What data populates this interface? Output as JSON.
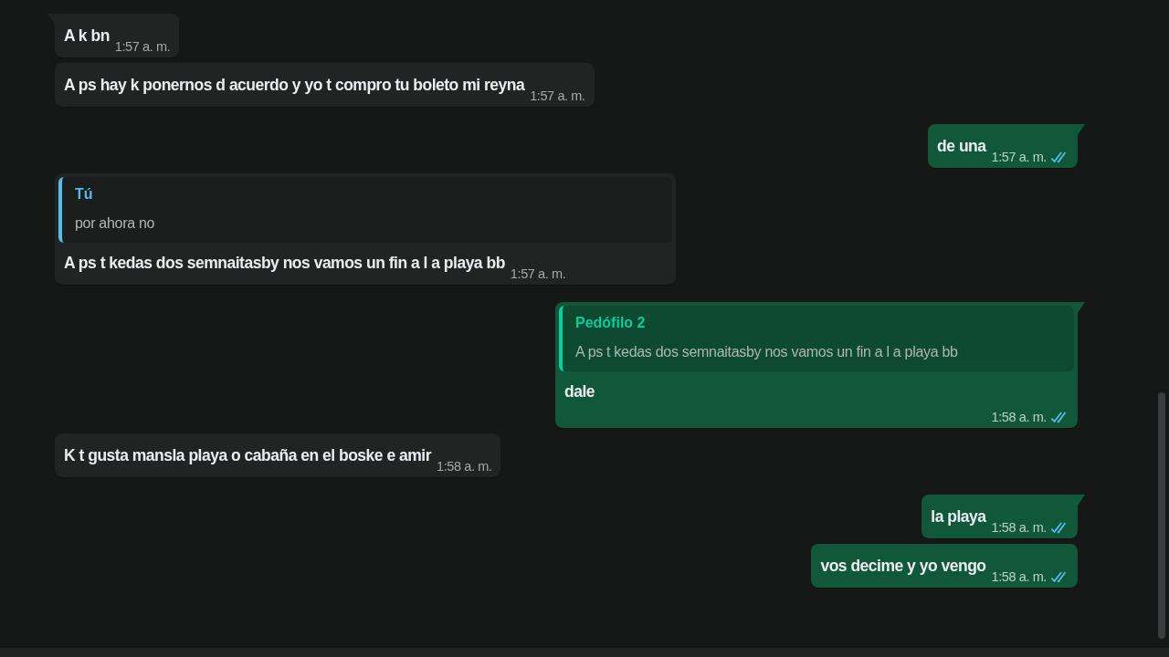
{
  "messages": [
    {
      "kind": "incoming",
      "tail": true,
      "text": "A k bn",
      "time": "1:57 a. m."
    },
    {
      "kind": "incoming",
      "tail": false,
      "text": "A ps hay k ponernos d acuerdo y yo t compro tu boleto mi reyna",
      "time": "1:57 a. m."
    },
    {
      "kind": "outgoing",
      "tail": true,
      "text": "de una",
      "time": "1:57 a. m.",
      "read": true
    },
    {
      "kind": "incoming",
      "tail": false,
      "quote": {
        "author": "Tú",
        "text": "por ahora no"
      },
      "text": "A ps t kedas dos semnaitasby nos vamos un fin a l a playa bb",
      "time": "1:57 a. m."
    },
    {
      "kind": "outgoing",
      "tail": true,
      "quote": {
        "author": "Pedófilo 2",
        "text": "A ps t kedas dos semnaitasby nos vamos un fin a l a playa bb"
      },
      "text": "dale",
      "time": "1:58 a. m.",
      "read": true
    },
    {
      "kind": "incoming",
      "tail": false,
      "text": "K t gusta mansla playa o cabaña en el boske e amir",
      "time": "1:58 a. m."
    },
    {
      "kind": "outgoing",
      "tail": true,
      "text": "la playa",
      "time": "1:58 a. m.",
      "read": true
    },
    {
      "kind": "outgoing",
      "tail": false,
      "text": "vos decime y yo vengo",
      "time": "1:58 a. m.",
      "read": true
    }
  ]
}
